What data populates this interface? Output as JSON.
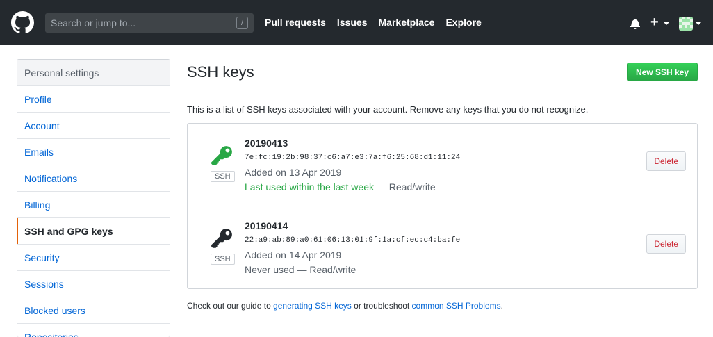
{
  "header": {
    "search_placeholder": "Search or jump to...",
    "search_shortcut": "/",
    "nav": [
      "Pull requests",
      "Issues",
      "Marketplace",
      "Explore"
    ],
    "plus": "+"
  },
  "sidebar": {
    "heading": "Personal settings",
    "items": [
      {
        "label": "Profile"
      },
      {
        "label": "Account"
      },
      {
        "label": "Emails"
      },
      {
        "label": "Notifications"
      },
      {
        "label": "Billing"
      },
      {
        "label": "SSH and GPG keys"
      },
      {
        "label": "Security"
      },
      {
        "label": "Sessions"
      },
      {
        "label": "Blocked users"
      },
      {
        "label": "Repositories"
      }
    ],
    "active_index": 5
  },
  "main": {
    "title": "SSH keys",
    "new_button": "New SSH key",
    "intro": "This is a list of SSH keys associated with your account. Remove any keys that you do not recognize.",
    "keys": [
      {
        "name": "20190413",
        "fingerprint": "7e:fc:19:2b:98:37:c6:a7:e3:7a:f6:25:68:d1:11:24",
        "added": "Added on 13 Apr 2019",
        "usage": "Last used within the last week",
        "access": " — Read/write",
        "type": "SSH",
        "delete": "Delete",
        "icon_color": "#28a745"
      },
      {
        "name": "20190414",
        "fingerprint": "22:a9:ab:89:a0:61:06:13:01:9f:1a:cf:ec:c4:ba:fe",
        "added": "Added on 14 Apr 2019",
        "usage": "Never used",
        "access": " — Read/write",
        "type": "SSH",
        "delete": "Delete",
        "icon_color": "#24292e"
      }
    ],
    "footer": {
      "prefix": "Check out our guide to ",
      "link1": "generating SSH keys",
      "middle": " or troubleshoot ",
      "link2": "common SSH Problems",
      "suffix": "."
    }
  },
  "colors": {
    "header_bg": "#24292e",
    "link": "#0366d6",
    "primary_button": "#2cbe4e",
    "danger": "#cb2431",
    "active_marker": "#e36209"
  }
}
